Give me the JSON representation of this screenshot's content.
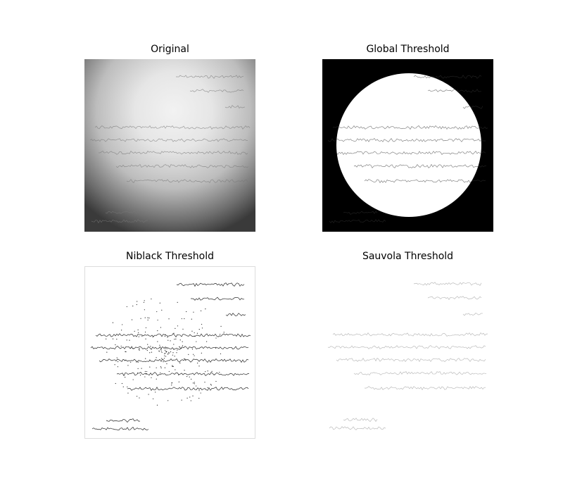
{
  "figure": {
    "panels": [
      {
        "title": "Original",
        "content": "grayscale scanned handwritten document with strong vignetting"
      },
      {
        "title": "Global Threshold",
        "content": "binary image: white circular region on black background"
      },
      {
        "title": "Niblack Threshold",
        "content": "binary image: dark handwriting with speckle noise on white"
      },
      {
        "title": "Sauvola Threshold",
        "content": "binary image: faint handwriting on white"
      }
    ]
  },
  "colors": {
    "background": "#ffffff",
    "ink": "#000000"
  }
}
